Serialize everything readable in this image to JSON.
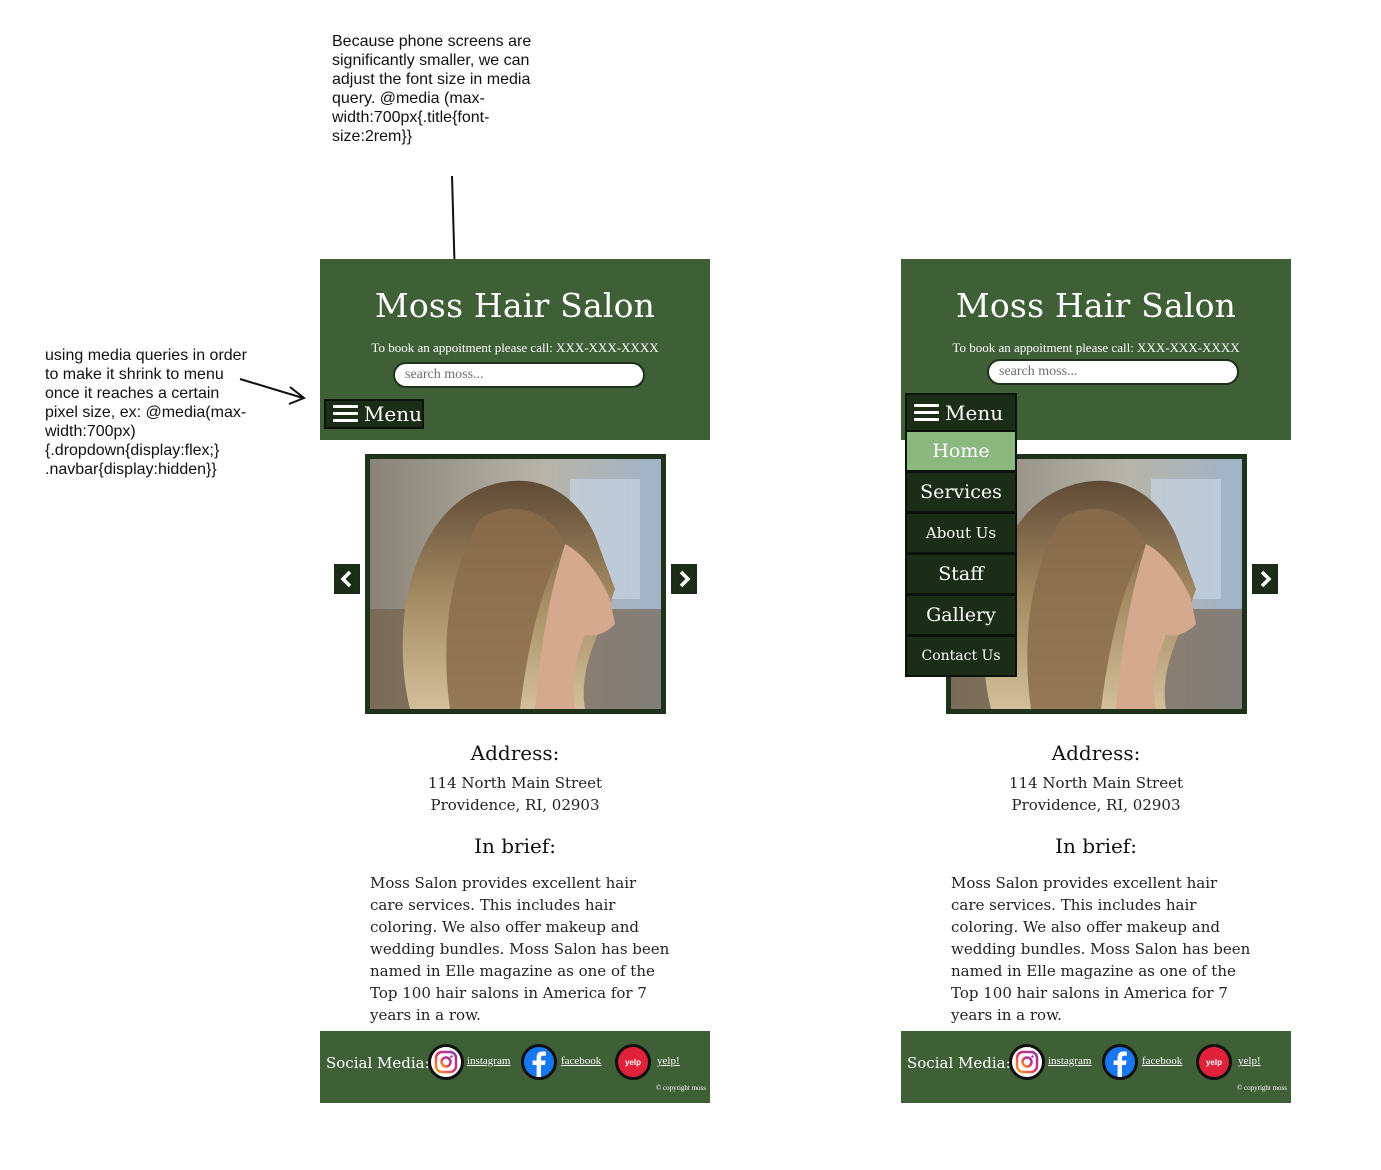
{
  "annotations": {
    "top_note": "Because phone screens are\nsignificantly smaller, we can\nadjust the font size in media\nquery. @media (max-\nwidth:700px{.title{font-\nsize:2rem}}",
    "left_note": "using media queries in order\nto make it shrink to menu\nonce it reaches a certain\npixel size, ex: @media(max-\nwidth:700px)\n{.dropdown{display:flex;}\n.navbar{display:hidden}}"
  },
  "site": {
    "title": "Moss Hair Salon",
    "booking_text": "To book an appoitment please call: XXX-XXX-XXXX",
    "search_placeholder": "search moss...",
    "menu_label": "Menu",
    "menu_items": [
      "Home",
      "Services",
      "About Us",
      "Staff",
      "Gallery",
      "Contact Us"
    ],
    "active_menu_item": "Home",
    "address_heading": "Address:",
    "address_line1": "114 North Main Street",
    "address_line2": "Providence, RI, 02903",
    "brief_heading": "In brief:",
    "brief_text": "Moss Salon provides excellent hair care services. This includes hair coloring. We also offer makeup and wedding bundles. Moss Salon has been named in Elle magazine as one of the Top 100 hair salons in America for 7 years in a row.",
    "social_label": "Social Media:",
    "social_links": [
      "instagram",
      "facebook",
      "yelp!"
    ],
    "yelp_icon_text": "yelp",
    "copyright": "© copyright moss"
  },
  "colors": {
    "header_green": "#3f5f37",
    "menu_dark": "#1c2d17",
    "active_item": "#8ab87f"
  },
  "icons": [
    "hamburger-icon",
    "chevron-left-icon",
    "chevron-right-icon",
    "instagram-icon",
    "facebook-icon",
    "yelp-icon"
  ]
}
